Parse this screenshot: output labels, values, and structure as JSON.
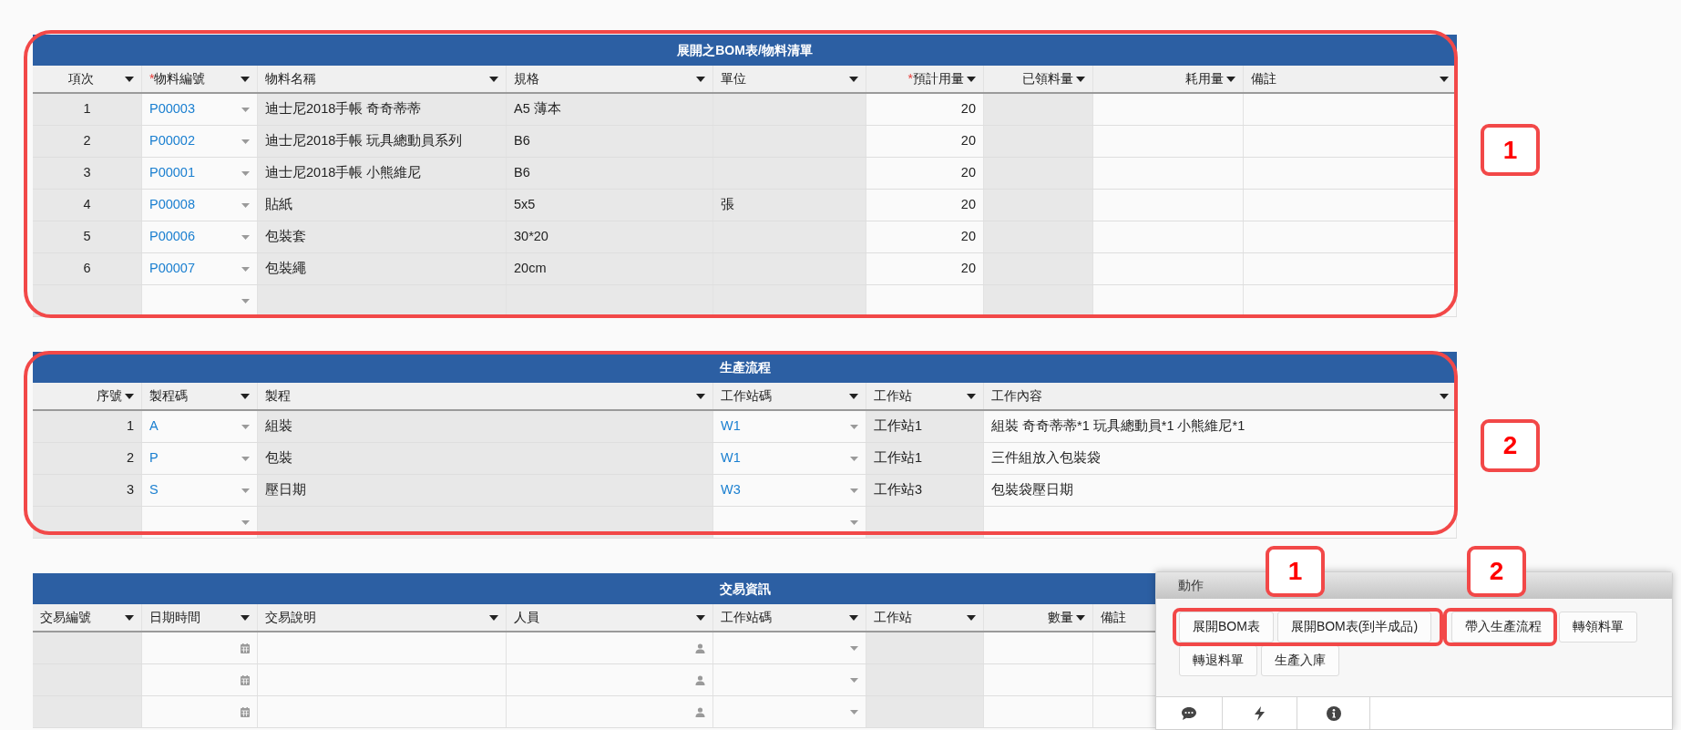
{
  "tables": [
    {
      "title": "展開之BOM表/物料清單",
      "columns": [
        {
          "label": "項次",
          "kind": "index"
        },
        {
          "label": "物料編號",
          "marker": "*",
          "kind": "lookup"
        },
        {
          "label": "物料名稱",
          "kind": "derived"
        },
        {
          "label": "規格",
          "kind": "derived"
        },
        {
          "label": "單位",
          "kind": "derived"
        },
        {
          "label": "預計用量",
          "marker": "*",
          "kind": "amount"
        },
        {
          "label": "已領料量",
          "kind": "tally"
        },
        {
          "label": "耗用量",
          "kind": "amount"
        },
        {
          "label": "備註",
          "kind": "text"
        }
      ],
      "rows": [
        [
          "1",
          "P00003",
          "迪士尼2018手帳 奇奇蒂蒂",
          "A5 薄本",
          null,
          "20",
          null,
          null,
          null
        ],
        [
          "2",
          "P00002",
          "迪士尼2018手帳 玩具總動員系列",
          "B6",
          null,
          "20",
          null,
          null,
          null
        ],
        [
          "3",
          "P00001",
          "迪士尼2018手帳 小熊維尼",
          "B6",
          null,
          "20",
          null,
          null,
          null
        ],
        [
          "4",
          "P00008",
          "貼紙",
          "5x5",
          "張",
          "20",
          null,
          null,
          null
        ],
        [
          "5",
          "P00006",
          "包裝套",
          "30*20",
          null,
          "20",
          null,
          null,
          null
        ],
        [
          "6",
          "P00007",
          "包裝繩",
          "20cm",
          null,
          "20",
          null,
          null,
          null
        ],
        [
          null,
          null,
          null,
          null,
          null,
          null,
          null,
          null,
          null
        ]
      ]
    },
    {
      "title": "生產流程",
      "columns": [
        {
          "label": "序號",
          "kind": "serial"
        },
        {
          "label": "製程碼",
          "kind": "lookup"
        },
        {
          "label": "製程",
          "kind": "derived"
        },
        {
          "label": "工作站碼",
          "kind": "lookup"
        },
        {
          "label": "工作站",
          "kind": "derived"
        },
        {
          "label": "工作內容",
          "kind": "text"
        }
      ],
      "rows": [
        [
          "1",
          "A",
          "組裝",
          "W1",
          "工作站1",
          "組裝 奇奇蒂蒂*1 玩具總動員*1 小熊維尼*1"
        ],
        [
          "2",
          "P",
          "包裝",
          "W1",
          "工作站1",
          "三件組放入包裝袋"
        ],
        [
          "3",
          "S",
          "壓日期",
          "W3",
          "工作站3",
          "包裝袋壓日期"
        ],
        [
          null,
          null,
          null,
          null,
          null,
          null
        ]
      ]
    },
    {
      "title": "交易資訊",
      "columns": [
        {
          "label": "交易編號",
          "kind": "derived"
        },
        {
          "label": "日期時間",
          "kind": "date"
        },
        {
          "label": "交易說明",
          "kind": "text"
        },
        {
          "label": "人員",
          "kind": "person"
        },
        {
          "label": "工作站碼",
          "kind": "lookup"
        },
        {
          "label": "工作站",
          "kind": "derived"
        },
        {
          "label": "數量",
          "kind": "amount"
        },
        {
          "label": "備註",
          "kind": "text"
        }
      ],
      "rows": [
        [
          null,
          null,
          null,
          null,
          null,
          null,
          null,
          null
        ],
        [
          null,
          null,
          null,
          null,
          null,
          null,
          null,
          null
        ],
        [
          null,
          null,
          null,
          null,
          null,
          null,
          null,
          null
        ]
      ]
    }
  ],
  "action_panel": {
    "title": "動作",
    "buttons": [
      "展開BOM表",
      "展開BOM表(到半成品)",
      "帶入生產流程",
      "轉領料單",
      "轉退料單",
      "生產入庫"
    ]
  },
  "annotations": [
    {
      "label": "1"
    },
    {
      "label": "2"
    },
    {
      "label": "1"
    },
    {
      "label": "2"
    }
  ]
}
